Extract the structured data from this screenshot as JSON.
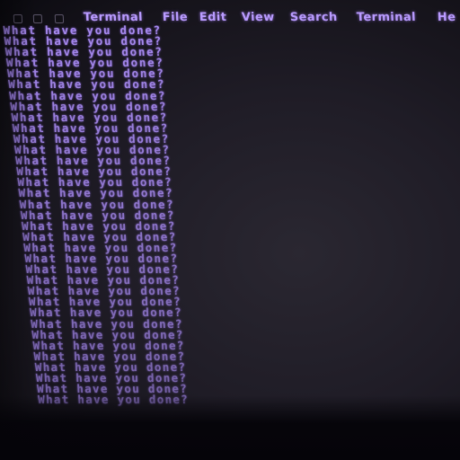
{
  "menubar": {
    "items": [
      "Terminal",
      "File",
      "Edit",
      "View",
      "Search",
      "Terminal",
      "He"
    ]
  },
  "terminal": {
    "line_text": "What have you done?",
    "lines": [
      "What have you done?",
      "What have you done?",
      "What have you done?",
      "What have you done?",
      "What have you done?",
      "What have you done?",
      "What have you done?",
      "What have you done?",
      "What have you done?",
      "What have you done?",
      "What have you done?",
      "What have you done?",
      "What have you done?",
      "What have you done?",
      "What have you done?",
      "What have you done?",
      "What have you done?",
      "What have you done?",
      "What have you done?",
      "What have you done?",
      "What have you done?",
      "What have you done?",
      "What have you done?",
      "What have you done?",
      "What have you done?",
      "What have you done?",
      "What have you done?",
      "What have you done?",
      "What have you done?",
      "What have you done?",
      "What have you done?",
      "What have you done?",
      "What have you done?",
      "What have you done?",
      "What have you done?"
    ]
  },
  "colors": {
    "text": "#a689ee",
    "menu_text": "#b99bff",
    "background": "#1f1c26"
  }
}
